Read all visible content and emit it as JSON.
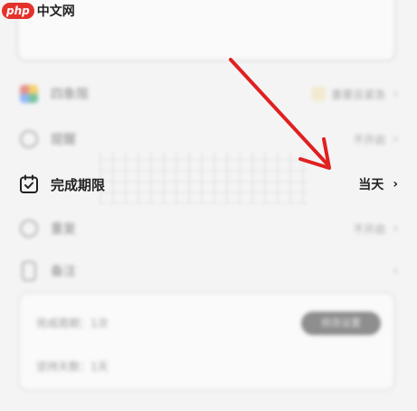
{
  "watermark": {
    "badge": "php",
    "text": "中文网"
  },
  "rows": {
    "quadrant": {
      "label": "四象限",
      "value": "重要且紧急"
    },
    "reminder": {
      "label": "提醒",
      "value": "不开启"
    },
    "deadline": {
      "label": "完成期限",
      "value": "当天"
    },
    "repeat": {
      "label": "重复",
      "value": "不开启"
    },
    "notes": {
      "label": "备注",
      "value": ""
    }
  },
  "info_card": {
    "line1": "完成周期：1次",
    "line2": "坚持天数：1天",
    "button": "修改设置"
  },
  "colors": {
    "annotation_arrow": "#e02020",
    "accent_text": "#222222"
  },
  "icons": {
    "deadline": "calendar-check-icon",
    "chevron": "chevron-right-icon"
  }
}
